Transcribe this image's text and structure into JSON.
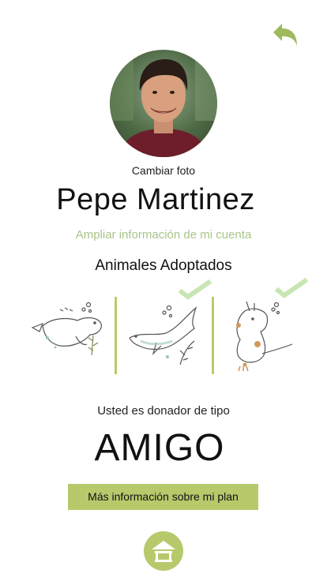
{
  "header": {
    "back_icon": "back-arrow-icon",
    "accent_color": "#b6c96b"
  },
  "profile": {
    "change_photo_label": "Cambiar foto",
    "name": "Pepe Martinez",
    "more_info_link": "Ampliar información de mi cuenta"
  },
  "adopted": {
    "title": "Animales Adoptados",
    "animals": [
      {
        "icon": "manatee-icon",
        "checked": false
      },
      {
        "icon": "dolphin-icon",
        "checked": true
      },
      {
        "icon": "otter-icon",
        "checked": true
      }
    ],
    "check_color": "#c8e6b4"
  },
  "donor": {
    "label": "Usted es donador de tipo",
    "type": "AMIGO",
    "plan_button": "Más información sobre mi plan"
  },
  "footer": {
    "home_icon": "home-icon"
  }
}
